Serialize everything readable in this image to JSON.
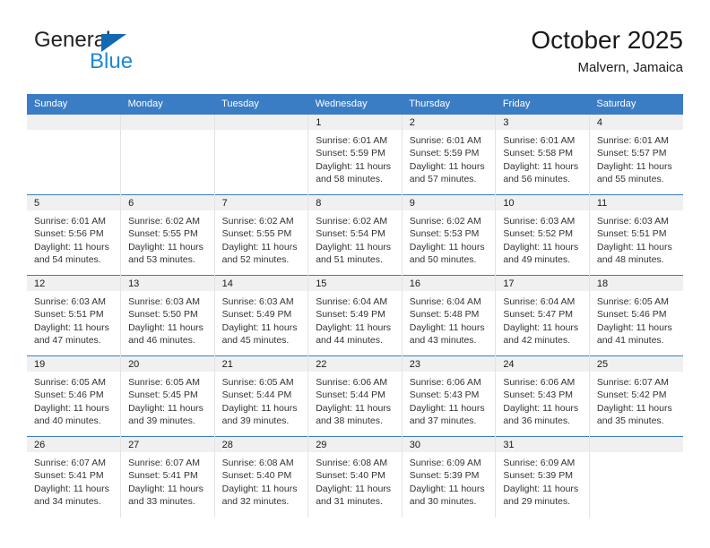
{
  "brand": {
    "name_part1": "General",
    "name_part2": "Blue",
    "triangle_icon": "blue-triangle-logo-mark"
  },
  "header": {
    "title": "October 2025",
    "location": "Malvern, Jamaica"
  },
  "colors": {
    "header_blue": "#3b7dc4",
    "brand_blue": "#1e87d6",
    "logo_mark_blue": "#1268b3",
    "daynum_band": "#f0f0f0",
    "cell_divider": "#e3e3e3",
    "text": "#333333"
  },
  "calendar": {
    "weekday_headers": [
      "Sunday",
      "Monday",
      "Tuesday",
      "Wednesday",
      "Thursday",
      "Friday",
      "Saturday"
    ],
    "labels": {
      "sunrise_prefix": "Sunrise:",
      "sunset_prefix": "Sunset:",
      "daylight_prefix": "Daylight:"
    },
    "weeks": [
      [
        {
          "day": "",
          "sunrise": "",
          "sunset": "",
          "daylight_line1": "",
          "daylight_line2": ""
        },
        {
          "day": "",
          "sunrise": "",
          "sunset": "",
          "daylight_line1": "",
          "daylight_line2": ""
        },
        {
          "day": "",
          "sunrise": "",
          "sunset": "",
          "daylight_line1": "",
          "daylight_line2": ""
        },
        {
          "day": "1",
          "sunrise": "Sunrise: 6:01 AM",
          "sunset": "Sunset: 5:59 PM",
          "daylight_line1": "Daylight: 11 hours",
          "daylight_line2": "and 58 minutes."
        },
        {
          "day": "2",
          "sunrise": "Sunrise: 6:01 AM",
          "sunset": "Sunset: 5:59 PM",
          "daylight_line1": "Daylight: 11 hours",
          "daylight_line2": "and 57 minutes."
        },
        {
          "day": "3",
          "sunrise": "Sunrise: 6:01 AM",
          "sunset": "Sunset: 5:58 PM",
          "daylight_line1": "Daylight: 11 hours",
          "daylight_line2": "and 56 minutes."
        },
        {
          "day": "4",
          "sunrise": "Sunrise: 6:01 AM",
          "sunset": "Sunset: 5:57 PM",
          "daylight_line1": "Daylight: 11 hours",
          "daylight_line2": "and 55 minutes."
        }
      ],
      [
        {
          "day": "5",
          "sunrise": "Sunrise: 6:01 AM",
          "sunset": "Sunset: 5:56 PM",
          "daylight_line1": "Daylight: 11 hours",
          "daylight_line2": "and 54 minutes."
        },
        {
          "day": "6",
          "sunrise": "Sunrise: 6:02 AM",
          "sunset": "Sunset: 5:55 PM",
          "daylight_line1": "Daylight: 11 hours",
          "daylight_line2": "and 53 minutes."
        },
        {
          "day": "7",
          "sunrise": "Sunrise: 6:02 AM",
          "sunset": "Sunset: 5:55 PM",
          "daylight_line1": "Daylight: 11 hours",
          "daylight_line2": "and 52 minutes."
        },
        {
          "day": "8",
          "sunrise": "Sunrise: 6:02 AM",
          "sunset": "Sunset: 5:54 PM",
          "daylight_line1": "Daylight: 11 hours",
          "daylight_line2": "and 51 minutes."
        },
        {
          "day": "9",
          "sunrise": "Sunrise: 6:02 AM",
          "sunset": "Sunset: 5:53 PM",
          "daylight_line1": "Daylight: 11 hours",
          "daylight_line2": "and 50 minutes."
        },
        {
          "day": "10",
          "sunrise": "Sunrise: 6:03 AM",
          "sunset": "Sunset: 5:52 PM",
          "daylight_line1": "Daylight: 11 hours",
          "daylight_line2": "and 49 minutes."
        },
        {
          "day": "11",
          "sunrise": "Sunrise: 6:03 AM",
          "sunset": "Sunset: 5:51 PM",
          "daylight_line1": "Daylight: 11 hours",
          "daylight_line2": "and 48 minutes."
        }
      ],
      [
        {
          "day": "12",
          "sunrise": "Sunrise: 6:03 AM",
          "sunset": "Sunset: 5:51 PM",
          "daylight_line1": "Daylight: 11 hours",
          "daylight_line2": "and 47 minutes."
        },
        {
          "day": "13",
          "sunrise": "Sunrise: 6:03 AM",
          "sunset": "Sunset: 5:50 PM",
          "daylight_line1": "Daylight: 11 hours",
          "daylight_line2": "and 46 minutes."
        },
        {
          "day": "14",
          "sunrise": "Sunrise: 6:03 AM",
          "sunset": "Sunset: 5:49 PM",
          "daylight_line1": "Daylight: 11 hours",
          "daylight_line2": "and 45 minutes."
        },
        {
          "day": "15",
          "sunrise": "Sunrise: 6:04 AM",
          "sunset": "Sunset: 5:49 PM",
          "daylight_line1": "Daylight: 11 hours",
          "daylight_line2": "and 44 minutes."
        },
        {
          "day": "16",
          "sunrise": "Sunrise: 6:04 AM",
          "sunset": "Sunset: 5:48 PM",
          "daylight_line1": "Daylight: 11 hours",
          "daylight_line2": "and 43 minutes."
        },
        {
          "day": "17",
          "sunrise": "Sunrise: 6:04 AM",
          "sunset": "Sunset: 5:47 PM",
          "daylight_line1": "Daylight: 11 hours",
          "daylight_line2": "and 42 minutes."
        },
        {
          "day": "18",
          "sunrise": "Sunrise: 6:05 AM",
          "sunset": "Sunset: 5:46 PM",
          "daylight_line1": "Daylight: 11 hours",
          "daylight_line2": "and 41 minutes."
        }
      ],
      [
        {
          "day": "19",
          "sunrise": "Sunrise: 6:05 AM",
          "sunset": "Sunset: 5:46 PM",
          "daylight_line1": "Daylight: 11 hours",
          "daylight_line2": "and 40 minutes."
        },
        {
          "day": "20",
          "sunrise": "Sunrise: 6:05 AM",
          "sunset": "Sunset: 5:45 PM",
          "daylight_line1": "Daylight: 11 hours",
          "daylight_line2": "and 39 minutes."
        },
        {
          "day": "21",
          "sunrise": "Sunrise: 6:05 AM",
          "sunset": "Sunset: 5:44 PM",
          "daylight_line1": "Daylight: 11 hours",
          "daylight_line2": "and 39 minutes."
        },
        {
          "day": "22",
          "sunrise": "Sunrise: 6:06 AM",
          "sunset": "Sunset: 5:44 PM",
          "daylight_line1": "Daylight: 11 hours",
          "daylight_line2": "and 38 minutes."
        },
        {
          "day": "23",
          "sunrise": "Sunrise: 6:06 AM",
          "sunset": "Sunset: 5:43 PM",
          "daylight_line1": "Daylight: 11 hours",
          "daylight_line2": "and 37 minutes."
        },
        {
          "day": "24",
          "sunrise": "Sunrise: 6:06 AM",
          "sunset": "Sunset: 5:43 PM",
          "daylight_line1": "Daylight: 11 hours",
          "daylight_line2": "and 36 minutes."
        },
        {
          "day": "25",
          "sunrise": "Sunrise: 6:07 AM",
          "sunset": "Sunset: 5:42 PM",
          "daylight_line1": "Daylight: 11 hours",
          "daylight_line2": "and 35 minutes."
        }
      ],
      [
        {
          "day": "26",
          "sunrise": "Sunrise: 6:07 AM",
          "sunset": "Sunset: 5:41 PM",
          "daylight_line1": "Daylight: 11 hours",
          "daylight_line2": "and 34 minutes."
        },
        {
          "day": "27",
          "sunrise": "Sunrise: 6:07 AM",
          "sunset": "Sunset: 5:41 PM",
          "daylight_line1": "Daylight: 11 hours",
          "daylight_line2": "and 33 minutes."
        },
        {
          "day": "28",
          "sunrise": "Sunrise: 6:08 AM",
          "sunset": "Sunset: 5:40 PM",
          "daylight_line1": "Daylight: 11 hours",
          "daylight_line2": "and 32 minutes."
        },
        {
          "day": "29",
          "sunrise": "Sunrise: 6:08 AM",
          "sunset": "Sunset: 5:40 PM",
          "daylight_line1": "Daylight: 11 hours",
          "daylight_line2": "and 31 minutes."
        },
        {
          "day": "30",
          "sunrise": "Sunrise: 6:09 AM",
          "sunset": "Sunset: 5:39 PM",
          "daylight_line1": "Daylight: 11 hours",
          "daylight_line2": "and 30 minutes."
        },
        {
          "day": "31",
          "sunrise": "Sunrise: 6:09 AM",
          "sunset": "Sunset: 5:39 PM",
          "daylight_line1": "Daylight: 11 hours",
          "daylight_line2": "and 29 minutes."
        },
        {
          "day": "",
          "sunrise": "",
          "sunset": "",
          "daylight_line1": "",
          "daylight_line2": ""
        }
      ]
    ]
  }
}
